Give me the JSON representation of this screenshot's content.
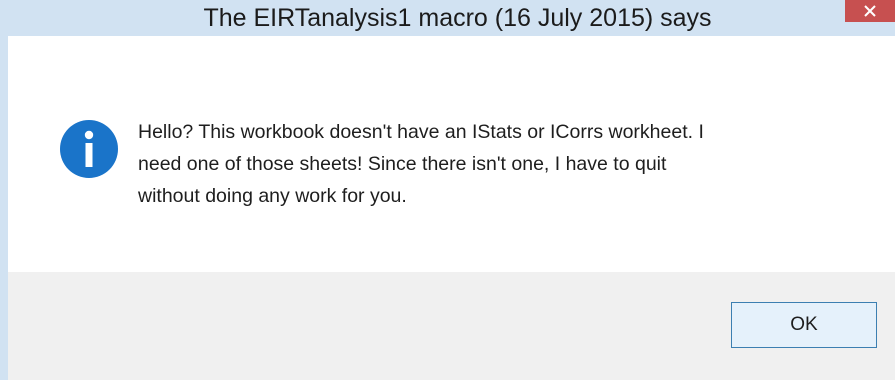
{
  "window": {
    "title": "The EIRTanalysis1 macro (16 July 2015) says",
    "close_icon": "close-icon"
  },
  "dialog": {
    "icon": "info-icon",
    "message_line1": "Hello? This workbook doesn't have an IStats or ICorrs workheet.  I",
    "message_line2": "need one of those sheets!  Since there isn't one, I have to quit",
    "message_line3": "without doing any work for you.",
    "ok_label": "OK"
  },
  "colors": {
    "titlebar": "#d1e2f2",
    "close_button": "#c75050",
    "info_icon": "#1a74c9",
    "footer": "#f0f0f0",
    "button_border": "#3c7fb1"
  }
}
